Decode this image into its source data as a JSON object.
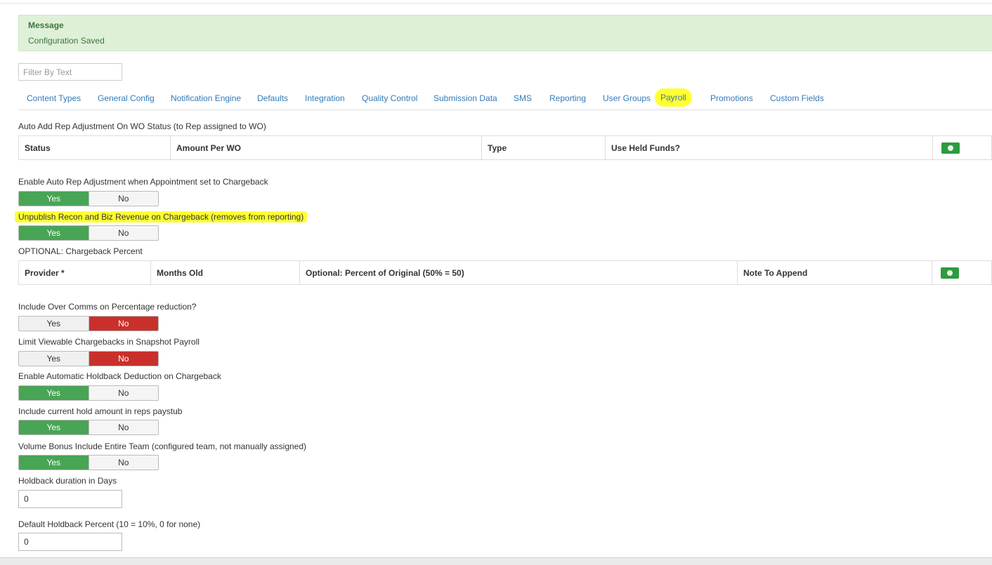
{
  "message": {
    "title": "Message",
    "text": "Configuration Saved"
  },
  "filter": {
    "placeholder": "Filter By Text"
  },
  "tabs": [
    "Content Types",
    "General Config",
    "Notification Engine",
    "Defaults",
    "Integration",
    "Quality Control",
    "Submission Data",
    "SMS",
    "Reporting",
    "User Groups",
    "Payroll",
    "Promotions",
    "Custom Fields"
  ],
  "active_tab": "Payroll",
  "section_auto_add": {
    "label": "Auto Add Rep Adjustment On WO Status (to Rep assigned to WO)",
    "columns": [
      "Status",
      "Amount Per WO",
      "Type",
      "Use Held Funds?"
    ]
  },
  "settings": [
    {
      "label": "Enable Auto Rep Adjustment when Appointment set to Chargeback",
      "yes": "Yes",
      "no": "No",
      "value": "Yes"
    },
    {
      "label": "Unpublish Recon and Biz Revenue on Chargeback (removes from reporting)",
      "yes": "Yes",
      "no": "No",
      "value": "Yes",
      "highlighted": true
    }
  ],
  "section_chargeback_percent": {
    "label": "OPTIONAL: Chargeback Percent",
    "columns": [
      "Provider *",
      "Months Old",
      "Optional: Percent of Original (50% = 50)",
      "Note To Append"
    ]
  },
  "settings2": [
    {
      "label": "Include Over Comms on Percentage reduction?",
      "yes": "Yes",
      "no": "No",
      "value": "No"
    },
    {
      "label": "Limit Viewable Chargebacks in Snapshot Payroll",
      "yes": "Yes",
      "no": "No",
      "value": "No"
    },
    {
      "label": "Enable Automatic Holdback Deduction on Chargeback",
      "yes": "Yes",
      "no": "No",
      "value": "Yes"
    },
    {
      "label": "Include current hold amount in reps paystub",
      "yes": "Yes",
      "no": "No",
      "value": "Yes"
    },
    {
      "label": "Volume Bonus Include Entire Team (configured team, not manually assigned)",
      "yes": "Yes",
      "no": "No",
      "value": "Yes"
    }
  ],
  "holdback_days": {
    "label": "Holdback duration in Days",
    "value": "0"
  },
  "holdback_percent": {
    "label": "Default Holdback Percent (10 = 10%, 0 for none)",
    "value": "0"
  },
  "colors": {
    "toggle_on_green": "#48a555",
    "toggle_on_red": "#c9302c",
    "highlight": "#ffff33",
    "link": "#337ab7",
    "message_bg": "#dff0d8"
  },
  "icons": {
    "add_row": "add-circle-icon"
  }
}
